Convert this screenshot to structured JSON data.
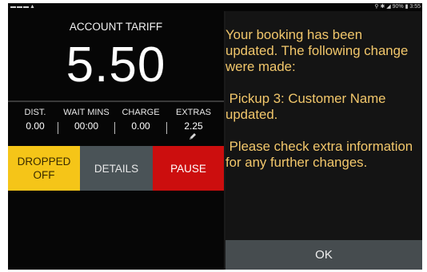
{
  "status_bar": {
    "left_icons": [
      "mail-icon",
      "image-icon",
      "mail-icon",
      "warning-icon"
    ],
    "left_glyphs": "▬▬▬▲",
    "right_text": "⚲ ✱ ◢ 90% ▮ 3:55",
    "battery": "90%",
    "time": "3:55"
  },
  "tariff": {
    "title": "ACCOUNT TARIFF",
    "amount": "5.50"
  },
  "metrics": [
    {
      "label": "DIST.",
      "value": "0.00"
    },
    {
      "label": "WAIT MINS",
      "value": "00:00"
    },
    {
      "label": "CHARGE",
      "value": "0.00"
    },
    {
      "label": "EXTRAS",
      "value": "2.25"
    }
  ],
  "buttons": {
    "dropped_off_line1": "DROPPED",
    "dropped_off_line2": "OFF",
    "details": "DETAILS",
    "pause": "PAUSE"
  },
  "dialog": {
    "paragraphs": [
      [
        "Your booking has been",
        "updated. The following change",
        "were made:"
      ],
      [
        " Pickup 3: Customer Name",
        "updated."
      ],
      [
        " Please check extra information",
        "for any further changes."
      ]
    ],
    "ok_label": "OK"
  },
  "colors": {
    "dropped_off": "#f5c518",
    "details": "#4a5357",
    "pause": "#cc0e0e",
    "dialog_text": "#f2c76b"
  }
}
